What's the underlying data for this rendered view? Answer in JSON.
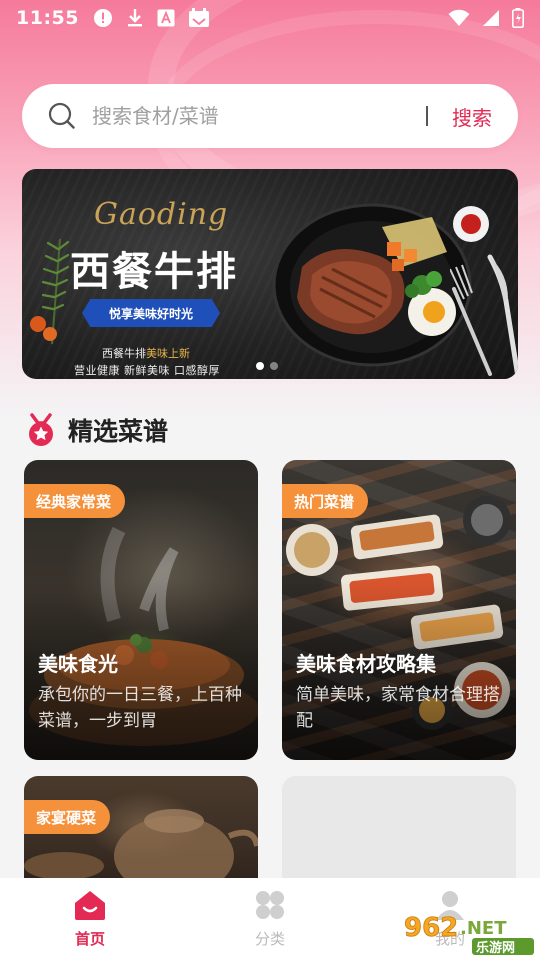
{
  "status_bar": {
    "time": "11:55",
    "left_icons": [
      "alert-circle-icon",
      "download-icon",
      "font-a-icon",
      "calendar-icon"
    ],
    "right_icons": [
      "wifi-icon",
      "signal-icon",
      "battery-icon"
    ]
  },
  "search": {
    "placeholder": "搜索食材/菜谱",
    "button_label": "搜索"
  },
  "banner": {
    "script_text": "Gaoding",
    "title": "西餐牛排",
    "ribbon": "悦享美味好时光",
    "line1_prefix": "西餐牛排",
    "line1_highlight": "美味上新",
    "line2": "营业健康  新鲜美味  口感醇厚",
    "slide_count": 2,
    "active_slide": 0
  },
  "section": {
    "title": "精选菜谱",
    "icon": "medal-icon"
  },
  "cards": [
    {
      "tag": "经典家常菜",
      "title": "美味食光",
      "desc": "承包你的一日三餐，上百种菜谱，一步到胃"
    },
    {
      "tag": "热门菜谱",
      "title": "美味食材攻略集",
      "desc": "简单美味，家常食材合理搭配"
    },
    {
      "tag": "家宴硬菜",
      "title": "",
      "desc": ""
    },
    {
      "tag": "",
      "title": "",
      "desc": ""
    }
  ],
  "bottom_nav": [
    {
      "label": "首页",
      "icon": "home-icon",
      "active": true
    },
    {
      "label": "分类",
      "icon": "category-grid-icon",
      "active": false
    },
    {
      "label": "我的",
      "icon": "profile-icon",
      "active": false
    }
  ],
  "watermark": {
    "text_top": "962.NET",
    "text_bottom": "乐游网"
  },
  "colors": {
    "accent": "#e22a54",
    "tag_orange": "#f5913a",
    "header_pink": "#f57a9b",
    "banner_blue": "#1f4fb8",
    "banner_gold": "#c9a356"
  }
}
